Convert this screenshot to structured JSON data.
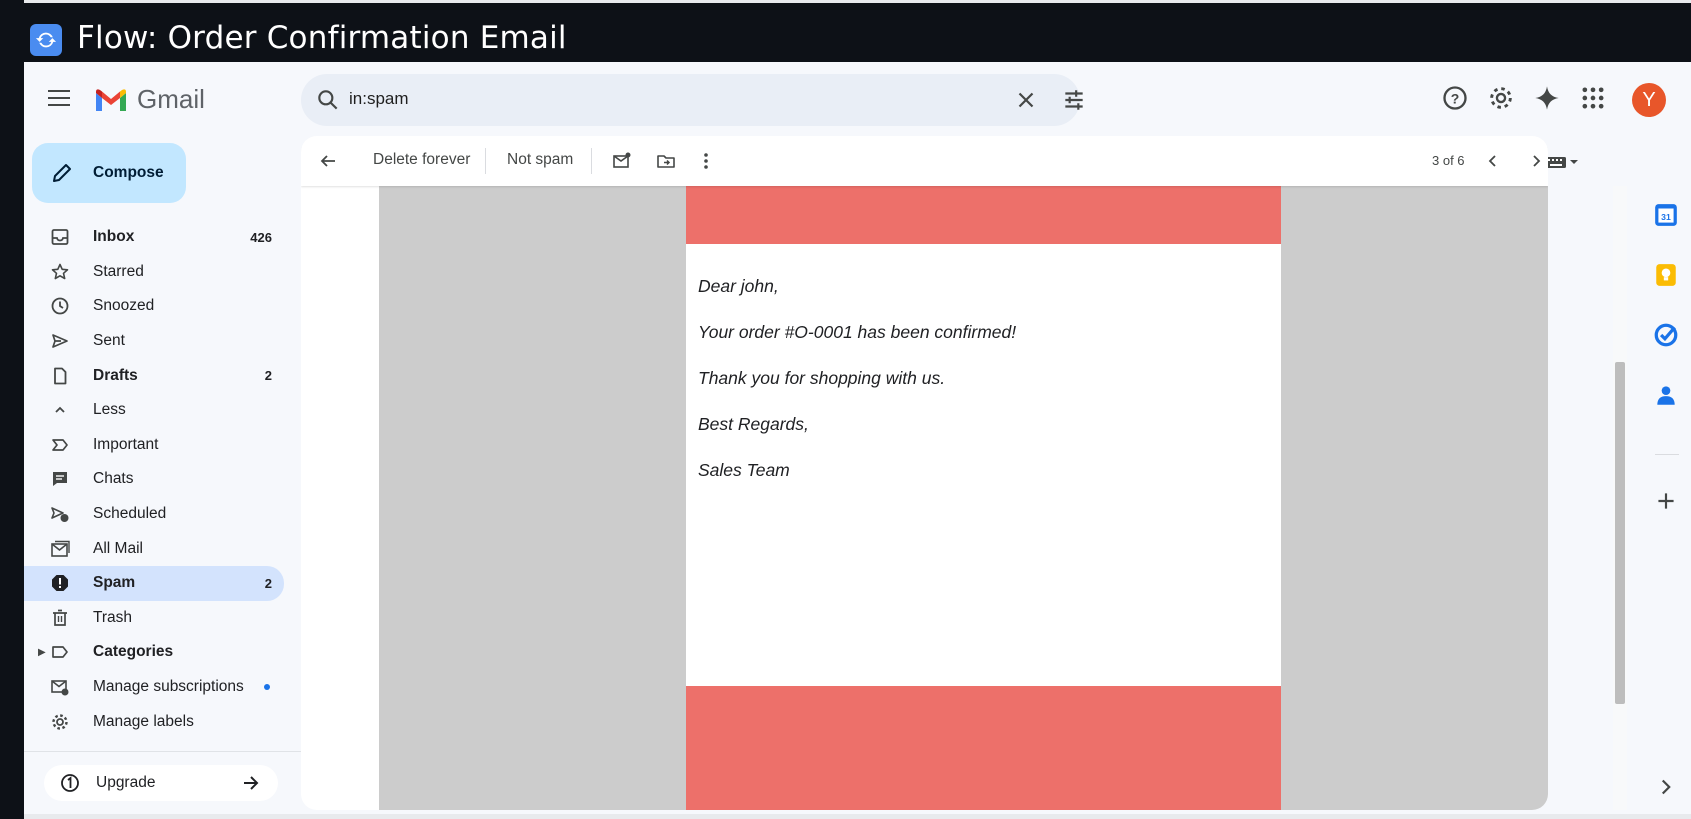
{
  "window": {
    "title": "Flow: Order Confirmation Email"
  },
  "header": {
    "logo_text": "Gmail",
    "search": {
      "query": "in:spam"
    },
    "avatar_initial": "Y"
  },
  "sidebar": {
    "compose_label": "Compose",
    "items": [
      {
        "label": "Inbox",
        "count": "426",
        "icon": "inbox-icon",
        "bold": true
      },
      {
        "label": "Starred",
        "count": "",
        "icon": "star-icon"
      },
      {
        "label": "Snoozed",
        "count": "",
        "icon": "clock-icon"
      },
      {
        "label": "Sent",
        "count": "",
        "icon": "send-icon"
      },
      {
        "label": "Drafts",
        "count": "2",
        "icon": "draft-icon",
        "bold": true
      },
      {
        "label": "Less",
        "count": "",
        "icon": "chevron-up-icon"
      },
      {
        "label": "Important",
        "count": "",
        "icon": "important-icon"
      },
      {
        "label": "Chats",
        "count": "",
        "icon": "chat-icon"
      },
      {
        "label": "Scheduled",
        "count": "",
        "icon": "scheduled-send-icon"
      },
      {
        "label": "All Mail",
        "count": "",
        "icon": "all-mail-icon"
      },
      {
        "label": "Spam",
        "count": "2",
        "icon": "spam-icon",
        "bold": true,
        "active": true
      },
      {
        "label": "Trash",
        "count": "",
        "icon": "trash-icon"
      },
      {
        "label": "Categories",
        "count": "",
        "icon": "label-icon",
        "bold": true
      },
      {
        "label": "Manage subscriptions",
        "count": "",
        "icon": "manage-subscriptions-icon"
      },
      {
        "label": "Manage labels",
        "count": "",
        "icon": "settings-icon"
      }
    ],
    "upgrade_label": "Upgrade"
  },
  "toolbar": {
    "delete_forever": "Delete forever",
    "not_spam": "Not spam",
    "pager": "3 of 6"
  },
  "email": {
    "lines": [
      "Dear john,",
      "Your order #O-0001 has been confirmed!",
      "Thank you for shopping with us.",
      "Best Regards,",
      "Sales Team"
    ],
    "band_color": "#ed706a"
  },
  "colors": {
    "accent": "#c2e7ff",
    "active_nav": "#d3e3fd",
    "avatar": "#e8562a"
  }
}
